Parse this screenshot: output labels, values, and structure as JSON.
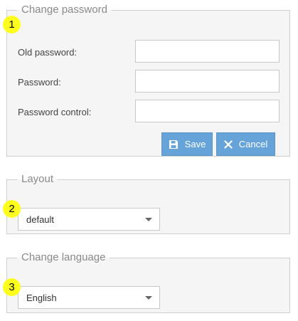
{
  "password_section": {
    "legend": "Change password",
    "old_password_label": "Old password:",
    "old_password_value": "",
    "password_label": "Password:",
    "password_value": "",
    "password_control_label": "Password control:",
    "password_control_value": "",
    "save_label": "Save",
    "save_icon": "floppy-disk-icon",
    "cancel_label": "Cancel",
    "cancel_icon": "close-icon",
    "button_color": "#66a3d9"
  },
  "layout_section": {
    "legend": "Layout",
    "selected": "default"
  },
  "language_section": {
    "legend": "Change language",
    "selected": "English"
  },
  "badges": [
    "1",
    "2",
    "3"
  ],
  "colors": {
    "badge": "#ffff1e",
    "panel_bg": "#f5f5f5",
    "panel_border": "#cfcfcf"
  }
}
